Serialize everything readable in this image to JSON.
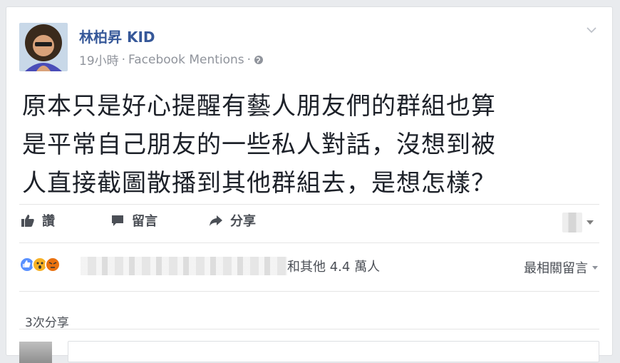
{
  "post": {
    "author": "林柏昇 KID",
    "time": "19小時",
    "separator": "·",
    "source": "Facebook Mentions",
    "separator2": "·",
    "text_lines": [
      "原本只是好心提醒有藝人朋友們的群組也算",
      "是平常自己朋友的一些私人對話，沒想到被",
      "人直接截圖散播到其他群組去，是想怎樣？"
    ]
  },
  "actions": {
    "like_label": "讚",
    "comment_label": "留言",
    "share_label": "分享"
  },
  "reactions": {
    "types": [
      "like",
      "wow",
      "angry"
    ],
    "others_text": "和其他 4.4 萬人"
  },
  "sort": {
    "label": "最相關留言"
  },
  "shares": {
    "label": "3次分享"
  },
  "colors": {
    "link": "#365899",
    "text": "#1d2129",
    "meta": "#90949c",
    "like_blue": "#5890ff",
    "wow_yellow": "#f7b125",
    "angry_orange": "#e9710f"
  },
  "icons": {
    "globe": "globe-icon",
    "like": "thumbs-up-icon",
    "comment": "speech-bubble-icon",
    "share": "share-arrow-icon",
    "chevron": "chevron-down-icon"
  }
}
